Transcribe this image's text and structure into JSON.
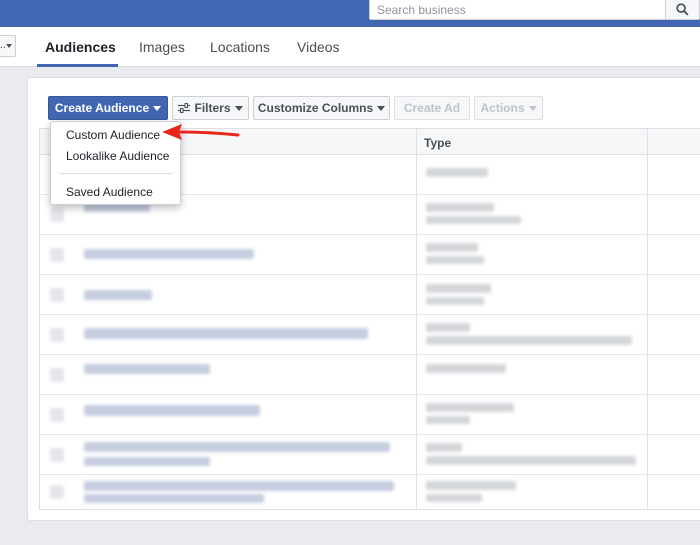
{
  "search": {
    "placeholder": "Search business"
  },
  "tabs": [
    {
      "label": "Audiences",
      "active": true
    },
    {
      "label": "Images"
    },
    {
      "label": "Locations"
    },
    {
      "label": "Videos"
    }
  ],
  "back_label": "...",
  "toolbar": {
    "create_audience": "Create Audience",
    "filters": "Filters",
    "customize_columns": "Customize Columns",
    "create_ad": "Create Ad",
    "actions": "Actions"
  },
  "table": {
    "type_header": "Type"
  },
  "dropdown": {
    "items": [
      "Custom Audience",
      "Lookalike Audience",
      "Saved Audience"
    ]
  },
  "colors": {
    "brand": "#4267b2",
    "arrow": "#e8261c"
  },
  "icons": {
    "search": "search-icon",
    "filters": "sliders-icon",
    "caret": "caret-down-icon"
  }
}
